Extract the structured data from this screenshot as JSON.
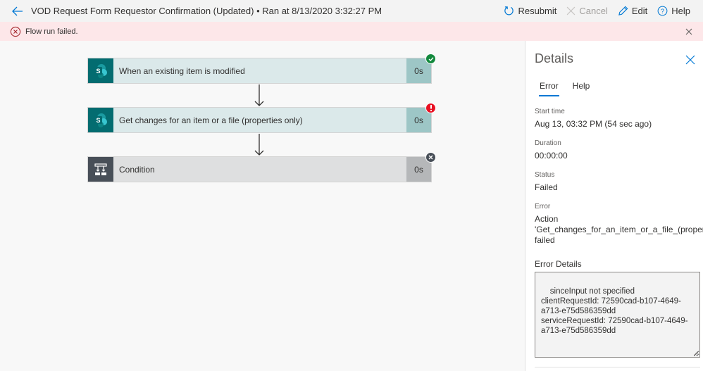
{
  "header": {
    "title": "VOD Request Form Requestor Confirmation (Updated) • Ran at 8/13/2020 3:32:27 PM",
    "back_icon": "arrow-left-icon",
    "commands": [
      {
        "label": "Resubmit",
        "icon": "refresh-icon",
        "enabled": true
      },
      {
        "label": "Cancel",
        "icon": "close-icon",
        "enabled": false
      },
      {
        "label": "Edit",
        "icon": "pencil-icon",
        "enabled": true
      },
      {
        "label": "Help",
        "icon": "help-circle-icon",
        "enabled": true
      }
    ]
  },
  "banner": {
    "message": "Flow run failed.",
    "icon": "error-circle-icon",
    "status_color": "#a4262c"
  },
  "flow": {
    "steps": [
      {
        "label": "When an existing item is modified",
        "duration": "0s",
        "connector": "SharePoint",
        "status": "succeeded",
        "icon": "sharepoint-icon"
      },
      {
        "label": "Get changes for an item or a file (properties only)",
        "duration": "0s",
        "connector": "SharePoint",
        "status": "failed",
        "icon": "sharepoint-icon"
      },
      {
        "label": "Condition",
        "duration": "0s",
        "connector": "Control",
        "status": "skipped",
        "icon": "condition-icon"
      }
    ],
    "colors": {
      "sharepoint": "#036c70",
      "success": "#13893d",
      "error": "#e81123",
      "skipped": "#484f58"
    }
  },
  "details": {
    "title": "Details",
    "tabs": [
      {
        "label": "Error",
        "active": true
      },
      {
        "label": "Help",
        "active": false
      }
    ],
    "fields": [
      {
        "label": "Start time",
        "value": "Aug 13, 03:32 PM (54 sec ago)"
      },
      {
        "label": "Duration",
        "value": "00:00:00"
      },
      {
        "label": "Status",
        "value": "Failed"
      },
      {
        "label": "Error",
        "value_lines": [
          "Action",
          "'Get_changes_for_an_item_or_a_file_(properties_",
          "failed"
        ]
      }
    ],
    "error_details_label": "Error Details",
    "error_details_text": "sinceInput not specified\nclientRequestId: 72590cad-b107-4649-\na713-e75d586359dd\nserviceRequestId: 72590cad-b107-4649-\na713-e75d586359dd"
  }
}
